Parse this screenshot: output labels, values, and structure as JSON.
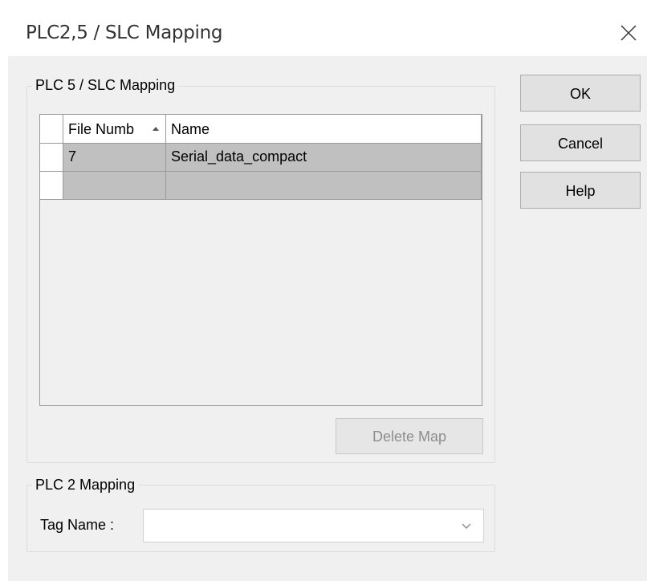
{
  "window": {
    "title": "PLC2,5 / SLC Mapping"
  },
  "plc5_group": {
    "title": "PLC 5 / SLC Mapping",
    "columns": [
      "File Numb",
      "Name"
    ],
    "rows": [
      {
        "file_number": "7",
        "name": "Serial_data_compact"
      },
      {
        "file_number": "",
        "name": ""
      }
    ],
    "delete_map_label": "Delete Map"
  },
  "plc2_group": {
    "title": "PLC 2 Mapping",
    "tag_name_label": "Tag Name :",
    "tag_name_value": ""
  },
  "buttons": {
    "ok": "OK",
    "cancel": "Cancel",
    "help": "Help"
  },
  "icons": {
    "close": "close-icon",
    "sort": "sort-ascending-icon",
    "dropdown": "chevron-down-icon"
  }
}
